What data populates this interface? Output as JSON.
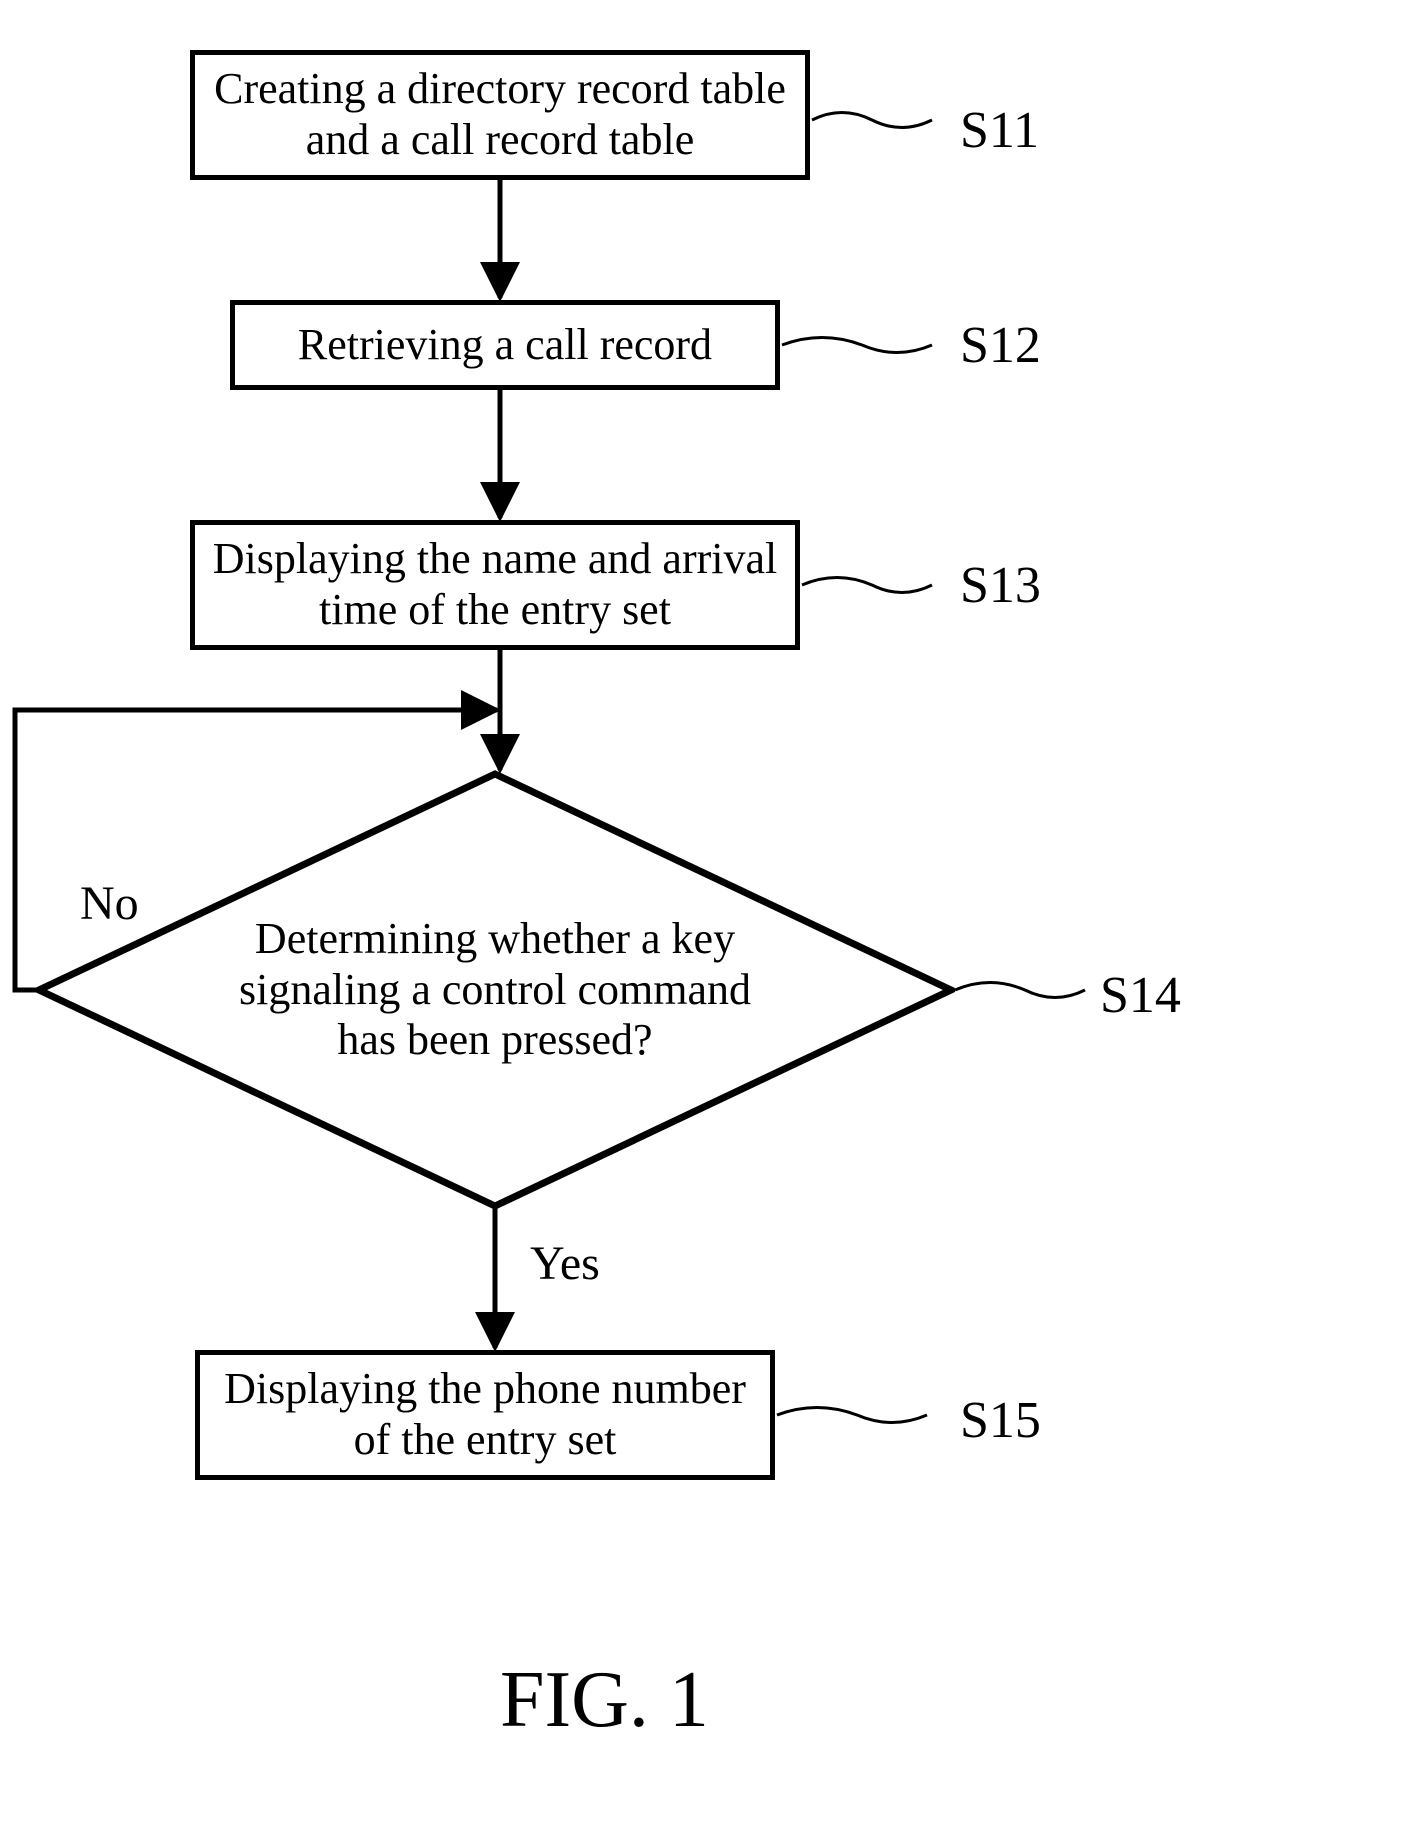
{
  "nodes": {
    "s11": {
      "text": "Creating a directory record table and a call record table",
      "label": "S11"
    },
    "s12": {
      "text": "Retrieving a call record",
      "label": "S12"
    },
    "s13": {
      "text": "Displaying the name and arrival time of the entry set",
      "label": "S13"
    },
    "s14": {
      "text": "Determining whether a key signaling a control command has been pressed?",
      "label": "S14"
    },
    "s15": {
      "text": "Displaying the phone number of the entry set",
      "label": "S15"
    }
  },
  "edges": {
    "no": "No",
    "yes": "Yes"
  },
  "caption": "FIG.  1",
  "chart_data": {
    "type": "flowchart",
    "nodes": [
      {
        "id": "S11",
        "shape": "process",
        "text": "Creating a directory record table and a call record table"
      },
      {
        "id": "S12",
        "shape": "process",
        "text": "Retrieving a call record"
      },
      {
        "id": "S13",
        "shape": "process",
        "text": "Displaying the name and arrival time of the entry set"
      },
      {
        "id": "S14",
        "shape": "decision",
        "text": "Determining whether a key signaling a control command has been pressed?"
      },
      {
        "id": "S15",
        "shape": "process",
        "text": "Displaying the phone number of the entry set"
      }
    ],
    "edges": [
      {
        "from": "S11",
        "to": "S12",
        "label": ""
      },
      {
        "from": "S12",
        "to": "S13",
        "label": ""
      },
      {
        "from": "S13",
        "to": "S14",
        "label": ""
      },
      {
        "from": "S14",
        "to": "S15",
        "label": "Yes"
      },
      {
        "from": "S14",
        "to": "S14",
        "label": "No"
      }
    ],
    "caption": "FIG. 1"
  }
}
